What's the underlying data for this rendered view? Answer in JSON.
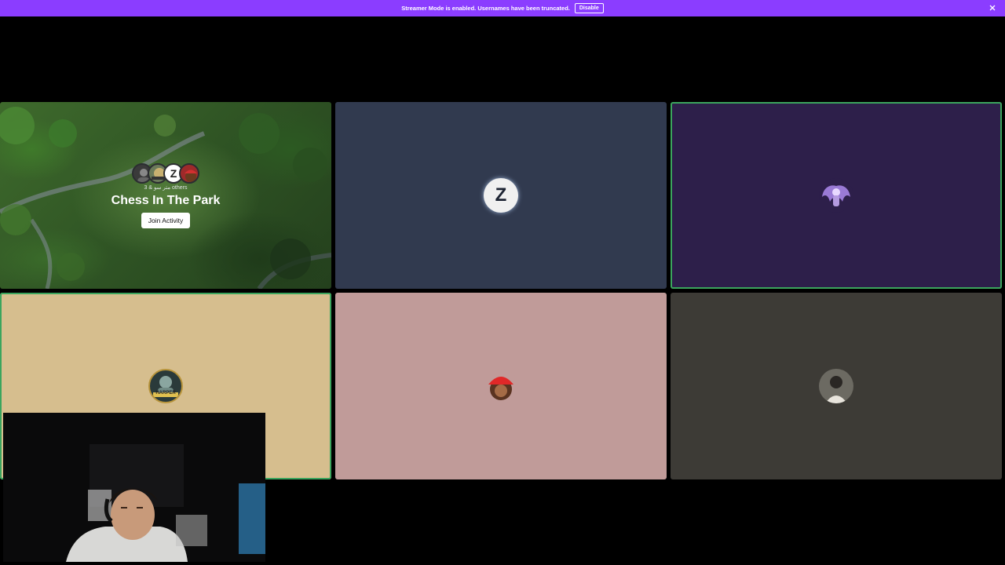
{
  "banner": {
    "message": "Streamer Mode is enabled. Usernames have been truncated.",
    "disable_label": "Disable",
    "close_icon": "close-icon",
    "color": "#8b3dff"
  },
  "activity": {
    "title": "Chess In The Park",
    "others_text": "3 & متر سو others",
    "join_label": "Join Activity",
    "participant_initial": "Z"
  },
  "tiles": [
    {
      "name": "participant-z",
      "bg": "#313a4f",
      "initial": "Z"
    },
    {
      "name": "participant-winged",
      "bg": "#2d1f4a",
      "speaking": true
    },
    {
      "name": "participant-harper",
      "bg": "#d6be8e",
      "speaking": true,
      "avatar_text": "HARPER"
    },
    {
      "name": "participant-red-cap",
      "bg": "#c09b99"
    },
    {
      "name": "participant-portrait",
      "bg": "#3d3b36"
    }
  ]
}
